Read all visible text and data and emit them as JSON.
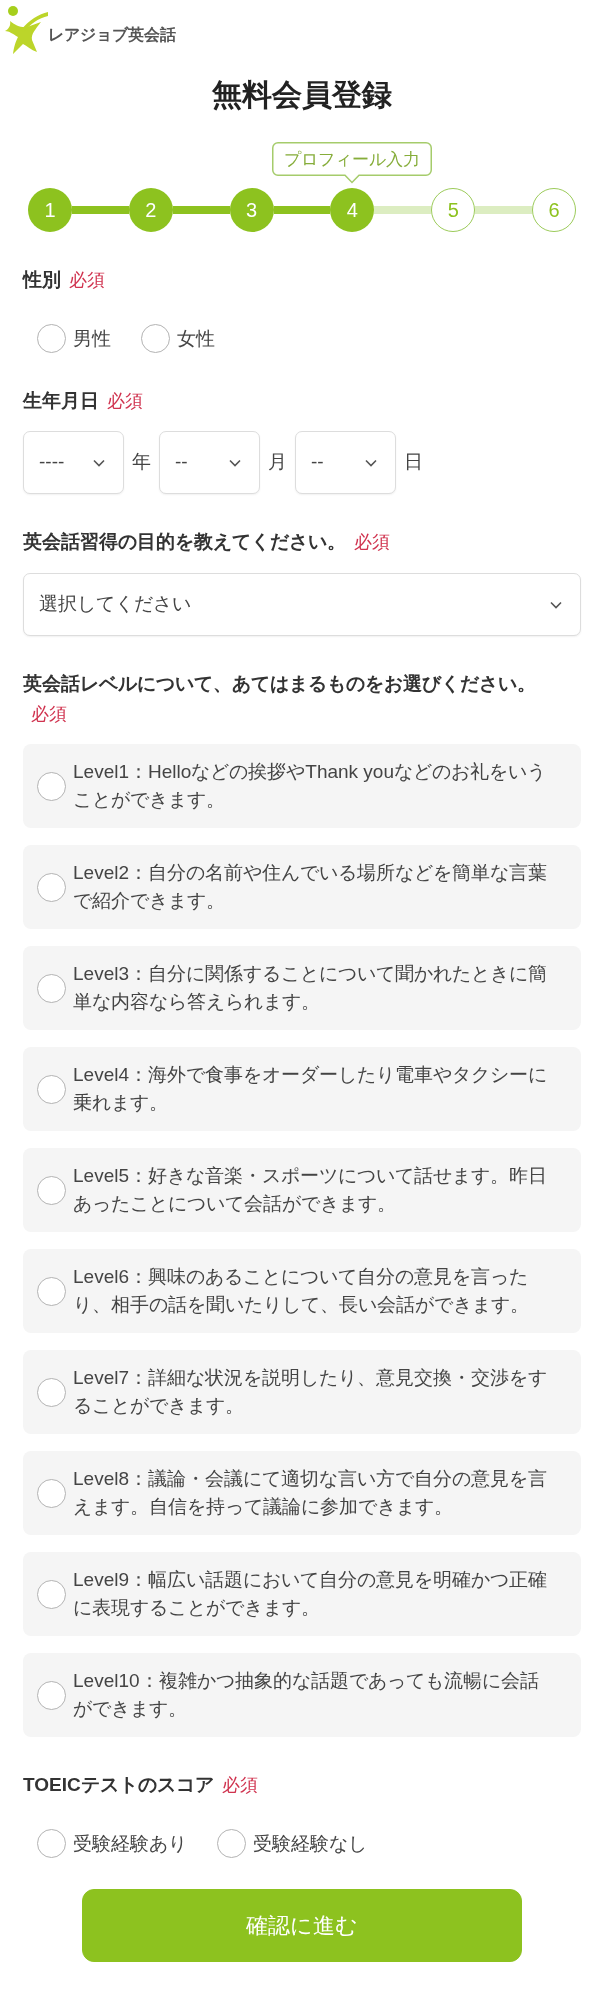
{
  "header": {
    "logo_text": "レアジョブ英会話"
  },
  "title": "無料会員登録",
  "stepper": {
    "steps": [
      {
        "label": "1",
        "reached": true
      },
      {
        "label": "2",
        "reached": true
      },
      {
        "label": "3",
        "reached": true
      },
      {
        "label": "4",
        "reached": true,
        "tooltip": "プロフィール入力"
      },
      {
        "label": "5",
        "reached": false
      },
      {
        "label": "6",
        "reached": false
      }
    ]
  },
  "sections": [
    {
      "kind": "radio-inline",
      "label": "性別",
      "required": "必須",
      "options": [
        {
          "label": "男性",
          "selected": false
        },
        {
          "label": "女性",
          "selected": false
        }
      ]
    },
    {
      "kind": "date",
      "label": "生年月日",
      "required": "必須",
      "fields": [
        {
          "value": "----",
          "unit": "年"
        },
        {
          "value": "--",
          "unit": "月"
        },
        {
          "value": "--",
          "unit": "日"
        }
      ]
    },
    {
      "kind": "select",
      "label": "英会話習得の目的を教えてください。",
      "required": "必須",
      "value": "選択してください"
    },
    {
      "kind": "radio-cards",
      "label": "英会話レベルについて、あてはまるものをお選びください。",
      "required": "必須",
      "options": [
        {
          "label": "Level1：Helloなどの挨拶やThank youなどのお礼をいうことができます。",
          "selected": false
        },
        {
          "label": "Level2：自分の名前や住んでいる場所などを簡単な言葉で紹介できます。",
          "selected": false
        },
        {
          "label": "Level3：自分に関係することについて聞かれたときに簡単な内容なら答えられます。",
          "selected": false
        },
        {
          "label": "Level4：海外で食事をオーダーしたり電車やタクシーに乗れます。",
          "selected": false
        },
        {
          "label": "Level5：好きな音楽・スポーツについて話せます。昨日あったことについて会話ができます。",
          "selected": false
        },
        {
          "label": "Level6：興味のあることについて自分の意見を言ったり、相手の話を聞いたりして、長い会話ができます。",
          "selected": false
        },
        {
          "label": "Level7：詳細な状況を説明したり、意見交換・交渉をすることができます。",
          "selected": false
        },
        {
          "label": "Level8：議論・会議にて適切な言い方で自分の意見を言えます。自信を持って議論に参加できます。",
          "selected": false
        },
        {
          "label": "Level9：幅広い話題において自分の意見を明確かつ正確に表現することができます。",
          "selected": false
        },
        {
          "label": "Level10：複雑かつ抽象的な話題であっても流暢に会話ができます。",
          "selected": false
        }
      ]
    },
    {
      "kind": "radio-inline",
      "label": "TOEICテストのスコア",
      "required": "必須",
      "options": [
        {
          "label": "受験経験あり",
          "selected": false
        },
        {
          "label": "受験経験なし",
          "selected": false
        }
      ]
    }
  ],
  "submit_button": "確認に進む"
}
